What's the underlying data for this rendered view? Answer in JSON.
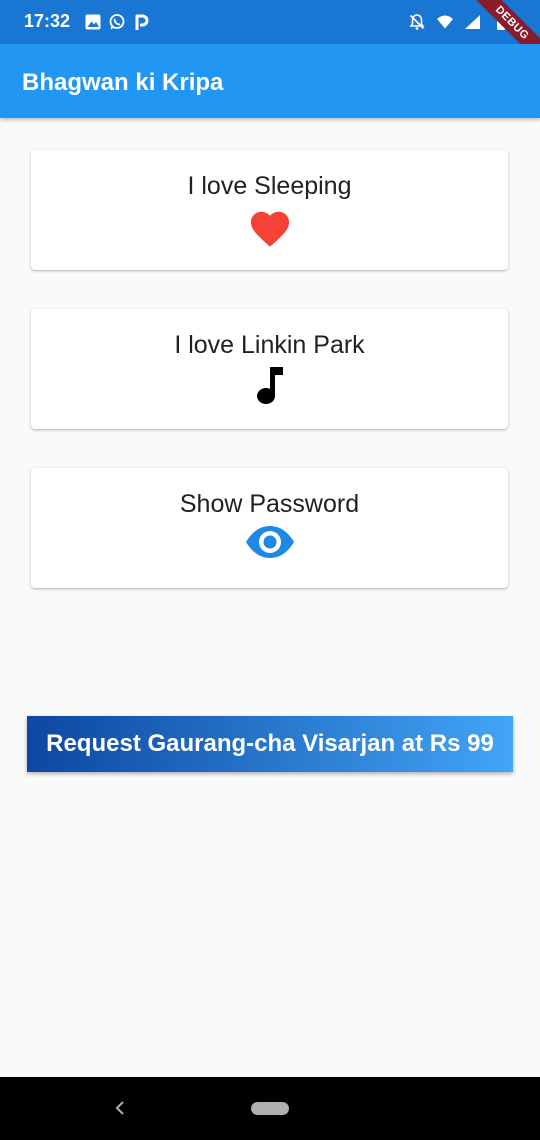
{
  "status_bar": {
    "time": "17:32",
    "left_icons": [
      "image-icon",
      "whatsapp-icon",
      "paytm-icon"
    ],
    "right_icons": [
      "notifications-off-icon",
      "wifi-icon",
      "signal-icon",
      "battery-icon"
    ],
    "background": "#1976d2"
  },
  "debug_banner": {
    "label": "DEBUG"
  },
  "app_bar": {
    "title": "Bhagwan ki Kripa",
    "background": "#2196f3"
  },
  "cards": [
    {
      "label": "I love Sleeping",
      "icon": "heart-icon",
      "icon_color": "#f44336"
    },
    {
      "label": "I love Linkin Park",
      "icon": "music-note-icon",
      "icon_color": "#000000"
    },
    {
      "label": "Show Password",
      "icon": "eye-icon",
      "icon_color": "#1e88e5"
    }
  ],
  "request_button": {
    "label": "Request Gaurang-cha Visarjan at Rs 99",
    "gradient": [
      "#0d47a1",
      "#42a5f5"
    ]
  },
  "nav_bar": {
    "icons": [
      "back-icon",
      "home-pill-icon"
    ]
  }
}
